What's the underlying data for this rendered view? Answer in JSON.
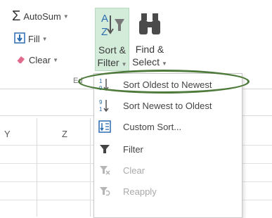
{
  "ribbon": {
    "autosum_label": "AutoSum",
    "fill_label": "Fill",
    "clear_label": "Clear",
    "sort_filter_line1": "Sort &",
    "sort_filter_line2": "Filter",
    "find_select_line1": "Find &",
    "find_select_line2": "Select",
    "group_label_partial": "Ed"
  },
  "grid": {
    "columns": [
      "Y",
      "Z"
    ]
  },
  "menu": {
    "items": [
      {
        "label": "Sort Oldest to Newest",
        "icon": "sort-ascending-icon",
        "enabled": true,
        "highlighted": true
      },
      {
        "label": "Sort Newest to Oldest",
        "icon": "sort-descending-icon",
        "enabled": true
      },
      {
        "label": "Custom Sort...",
        "icon": "custom-sort-icon",
        "enabled": true
      },
      {
        "label": "Filter",
        "icon": "filter-icon",
        "enabled": true
      },
      {
        "label": "Clear",
        "icon": "clear-filter-icon",
        "enabled": false
      },
      {
        "label": "Reapply",
        "icon": "reapply-icon",
        "enabled": false
      }
    ]
  },
  "colors": {
    "active_button_bg": "#d3ecd9",
    "highlight_ring": "#4e7a3c",
    "icon_blue": "#2b6cb0",
    "eraser_pink": "#e06b8c"
  }
}
